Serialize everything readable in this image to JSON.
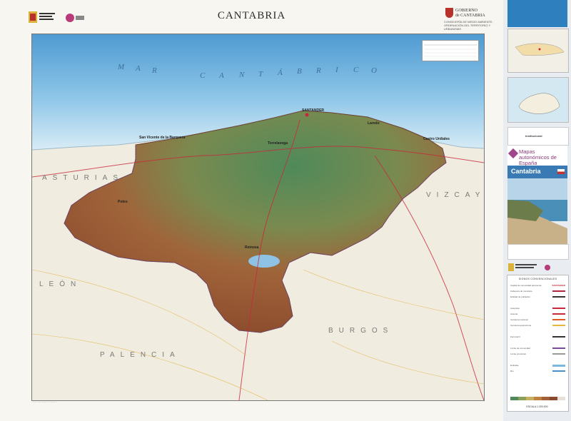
{
  "title": "CANTABRIA",
  "header": {
    "government_logo": "gobierno-de-espana-logo",
    "regional_logo_line1": "GOBIERNO",
    "regional_logo_line2": "de CANTABRIA",
    "regional_logo_sub": "CONSEJERÍA DE MEDIO AMBIENTE, ORDENACIÓN DEL TERRITORIO Y URBANISMO"
  },
  "map": {
    "sea_label": [
      "M",
      "A",
      "R",
      "C",
      "A",
      "N",
      "T",
      "Á",
      "B",
      "R",
      "I",
      "C",
      "O"
    ],
    "region_labels": [
      "ASTURIAS",
      "PALENCIA",
      "BURGOS",
      "VIZCAYA",
      "LEÓN"
    ],
    "capital": "SANTANDER",
    "places": [
      "Torrelavega",
      "Reinosa",
      "Castro Urdiales",
      "Laredo",
      "San Vicente de la Barquera",
      "Potes"
    ],
    "colors": {
      "sea_light": "#cfe6f3",
      "sea_deep": "#5ea6d6",
      "land_outside": "#f0ede0",
      "relief_green": "#5f8a5a",
      "relief_brown": "#9b5a3a",
      "reservoir": "#8ec3e6"
    }
  },
  "legend_box_lines": [
    "1",
    "2",
    "3"
  ],
  "panel": {
    "brand_name": "Mapas autonómicos de España",
    "cover_title": "Cantabria",
    "institutional_label": "Institucional",
    "scale_text": "ESCALA 1:200.000",
    "legend_title": "SIGNOS CONVENCIONALES",
    "legend_capital": "SANTANDER",
    "legend_rows": [
      "Capital de comunidad autónoma",
      "Cabecera de municipio",
      "Entidad de población",
      "Autopista",
      "Autovía",
      "Carretera nacional",
      "Carretera autonómica",
      "Ferrocarril",
      "Límite de comunidad",
      "Límite provincial",
      "Embalse",
      "Río"
    ],
    "legend_colors": [
      "#c8283c",
      "#b0283c",
      "#333333",
      "#c8283c",
      "#c8283c",
      "#e05a28",
      "#e8b840",
      "#333333",
      "#7a4aa0",
      "#9a9a9a",
      "#7cb8e0",
      "#4a90c8"
    ]
  }
}
